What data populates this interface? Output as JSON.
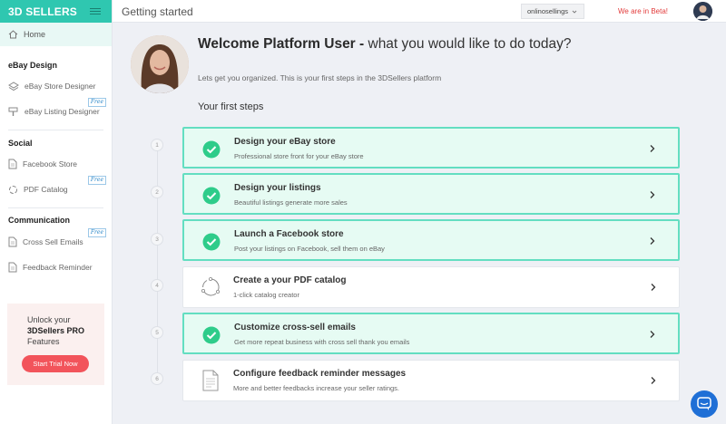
{
  "brand": {
    "name": "3D SELLERS"
  },
  "sidebar": {
    "home_label": "Home",
    "sections": [
      {
        "title": "eBay Design"
      },
      {
        "title": "Social"
      },
      {
        "title": "Communication"
      }
    ],
    "items": [
      {
        "label": "eBay Store Designer",
        "icon": "shop-icon",
        "badge": ""
      },
      {
        "label": "eBay Listing Designer",
        "icon": "paint-icon",
        "badge": "Free"
      },
      {
        "label": "Facebook Store",
        "icon": "document-icon",
        "badge": ""
      },
      {
        "label": "PDF Catalog",
        "icon": "catalog-icon",
        "badge": "Free"
      },
      {
        "label": "Cross Sell Emails",
        "icon": "document-icon",
        "badge": "Free"
      },
      {
        "label": "Feedback Reminder",
        "icon": "document-icon",
        "badge": ""
      }
    ],
    "promo": {
      "line1": "Unlock your",
      "line2": "3DSellers PRO",
      "line3": "Features",
      "button": "Start Trial Now"
    }
  },
  "topbar": {
    "page_title": "Getting started",
    "store_select": "onlinosellings",
    "beta_text": "We are in Beta!"
  },
  "main": {
    "welcome_bold": "Welcome Platform User -",
    "welcome_rest": " what you would like to do today?",
    "subtitle": "Lets get you organized. This is your first steps in the 3DSellers platform",
    "steps_title": "Your first steps",
    "steps": [
      {
        "num": "1",
        "title": "Design your eBay store",
        "desc": "Professional store front for your eBay store",
        "done": true
      },
      {
        "num": "2",
        "title": "Design your listings",
        "desc": "Beautiful listings generate more sales",
        "done": true
      },
      {
        "num": "3",
        "title": "Launch a Facebook store",
        "desc": "Post your listings on Facebook, sell them on eBay",
        "done": true
      },
      {
        "num": "4",
        "title": "Create a your PDF catalog",
        "desc": "1-click catalog creator",
        "done": false,
        "icon": "cycle-icon"
      },
      {
        "num": "5",
        "title": "Customize cross-sell emails",
        "desc": "Get more repeat business with cross sell thank you emails",
        "done": true
      },
      {
        "num": "6",
        "title": "Configure feedback reminder messages",
        "desc": "More and better feedbacks increase your seller ratings.",
        "done": false,
        "icon": "document-icon"
      }
    ]
  },
  "colors": {
    "brand": "#2fc7b0",
    "done_bg": "#e6fbf3",
    "done_border": "#63dec1",
    "check": "#2ecc8a",
    "trial_button": "#f2545b",
    "beta": "#e23b3b",
    "chat": "#1f6fd6"
  }
}
